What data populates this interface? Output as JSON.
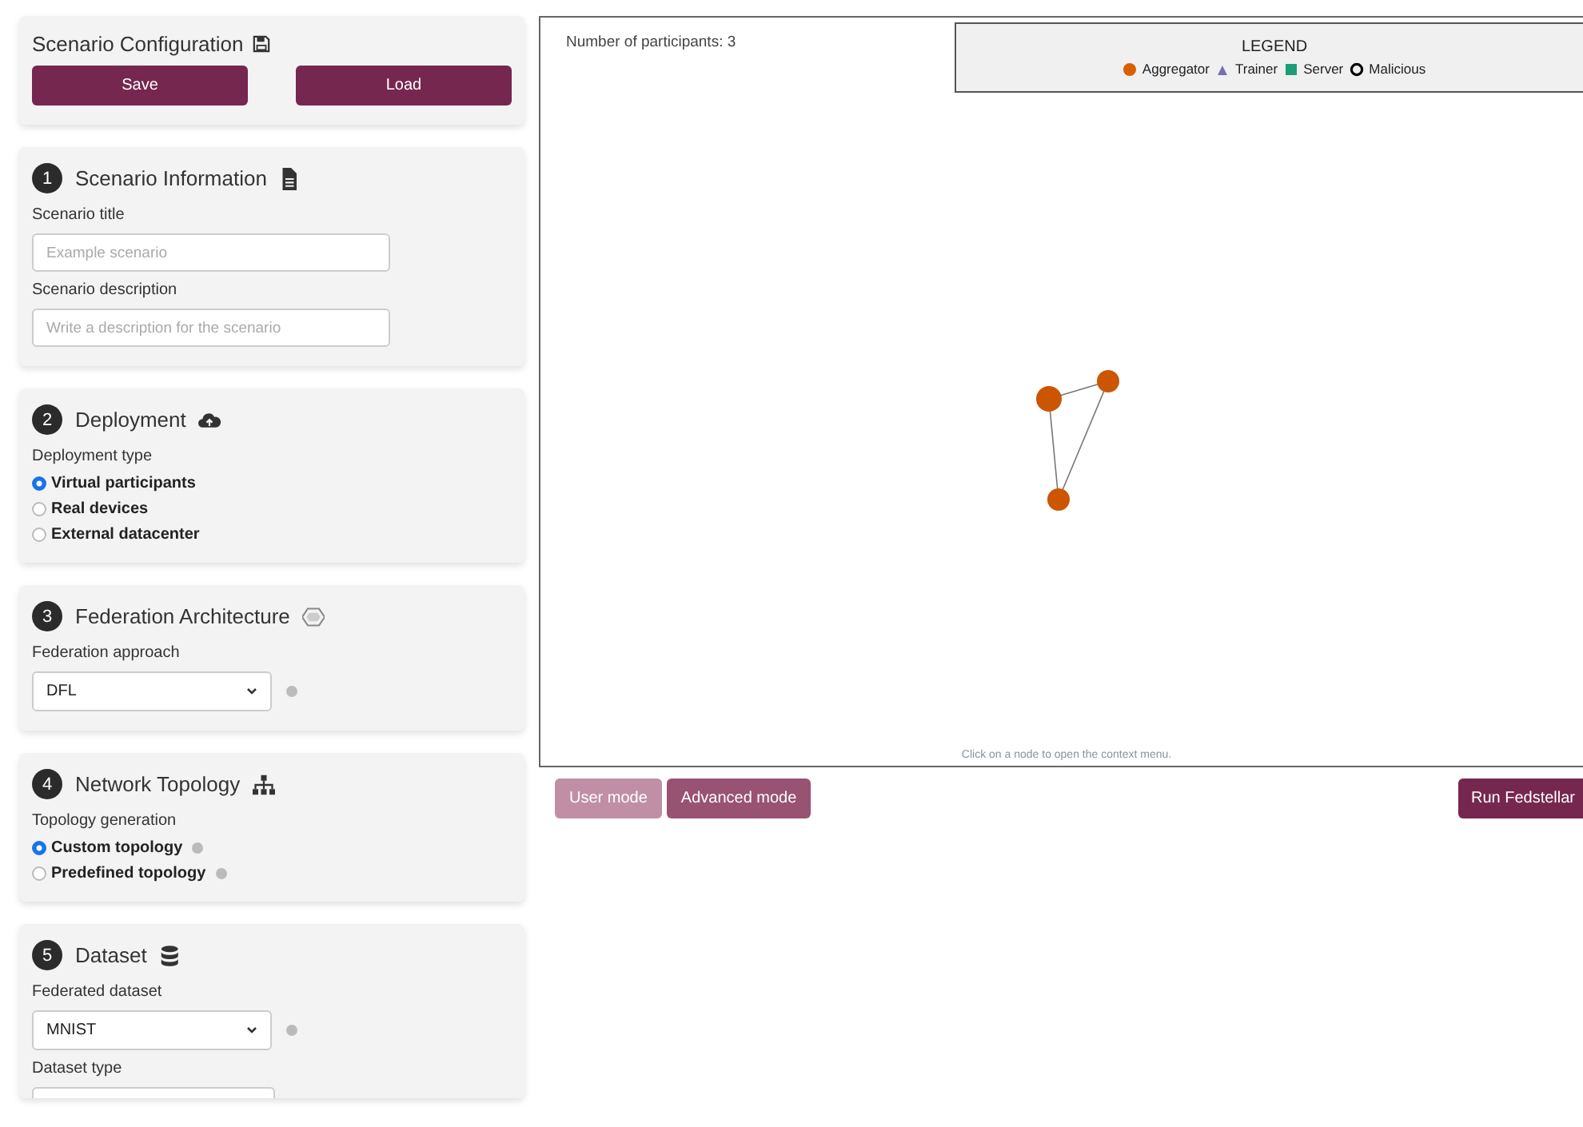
{
  "config": {
    "title": "Scenario Configuration",
    "buttons": [
      "Save",
      "Load"
    ]
  },
  "sections": [
    {
      "number": "1",
      "title": "Scenario Information",
      "fields": [
        {
          "kind": "input",
          "label": "Scenario title",
          "placeholder": "Example scenario"
        },
        {
          "kind": "input",
          "label": "Scenario description",
          "placeholder": "Write a description for the scenario"
        }
      ]
    },
    {
      "number": "2",
      "title": "Deployment",
      "fields": [
        {
          "kind": "radios",
          "label": "Deployment type",
          "options": [
            {
              "label": "Virtual participants",
              "selected": true,
              "info": false
            },
            {
              "label": "Real devices",
              "selected": false,
              "info": false
            },
            {
              "label": "External datacenter",
              "selected": false,
              "info": false
            }
          ]
        }
      ]
    },
    {
      "number": "3",
      "title": "Federation Architecture",
      "fields": [
        {
          "kind": "select",
          "label": "Federation approach",
          "value": "DFL"
        }
      ]
    },
    {
      "number": "4",
      "title": "Network Topology",
      "fields": [
        {
          "kind": "radios",
          "label": "Topology generation",
          "options": [
            {
              "label": "Custom topology",
              "selected": true,
              "info": true
            },
            {
              "label": "Predefined topology",
              "selected": false,
              "info": true
            }
          ]
        }
      ]
    },
    {
      "number": "5",
      "title": "Dataset",
      "fields": [
        {
          "kind": "select",
          "label": "Federated dataset",
          "value": "MNIST"
        },
        {
          "kind": "cutfield",
          "label": "Dataset type"
        }
      ]
    }
  ],
  "graph_panel": {
    "participants": "Number of participants: 3",
    "legend": {
      "title": "LEGEND",
      "items": [
        {
          "kind": "circle",
          "label": "Aggregator",
          "color": "#d95f02"
        },
        {
          "kind": "triangle",
          "label": "Trainer",
          "color": "#7570b3"
        },
        {
          "kind": "square",
          "label": "Server",
          "color": "#1b9e77"
        },
        {
          "kind": "ring",
          "label": "Malicious",
          "color": "#000000"
        }
      ]
    },
    "nodes": [
      {
        "kind": "aggregator"
      },
      {
        "kind": "aggregator"
      },
      {
        "kind": "aggregator"
      }
    ],
    "hint": "Click on a node to open the context menu."
  },
  "mode_buttons": [
    {
      "label": "User mode",
      "disabled": true
    },
    {
      "label": "Advanced mode",
      "disabled": false
    }
  ],
  "run_button": "Run Fedstellar"
}
